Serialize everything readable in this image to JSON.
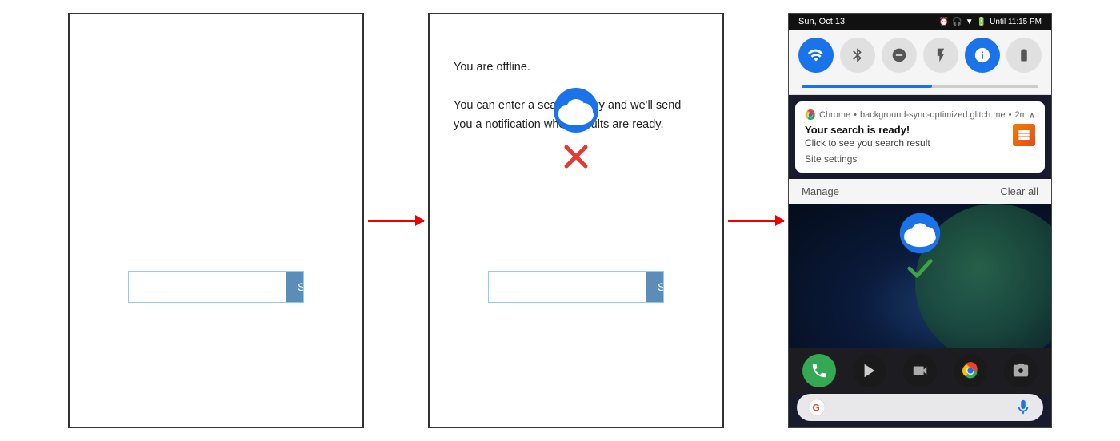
{
  "frame1": {
    "search_button": "Search",
    "search_placeholder": ""
  },
  "frame2": {
    "offline_text_line1": "You are offline.",
    "offline_text_line2": "You can enter a search query and we'll send",
    "offline_text_line3": "you a notification when results are ready.",
    "search_button": "Search",
    "search_placeholder": ""
  },
  "android": {
    "status_bar": {
      "date": "Sun, Oct 13",
      "time": "Until 11:15 PM"
    },
    "notification": {
      "source": "Chrome",
      "site": "background-sync-optimized.glitch.me",
      "time_ago": "2m",
      "title": "Your search is ready!",
      "body": "Click to see you search result",
      "settings_link": "Site settings"
    },
    "action_bar": {
      "manage": "Manage",
      "clear_all": "Clear all"
    },
    "google_bar_placeholder": "G"
  },
  "arrows": {
    "label": "→"
  }
}
